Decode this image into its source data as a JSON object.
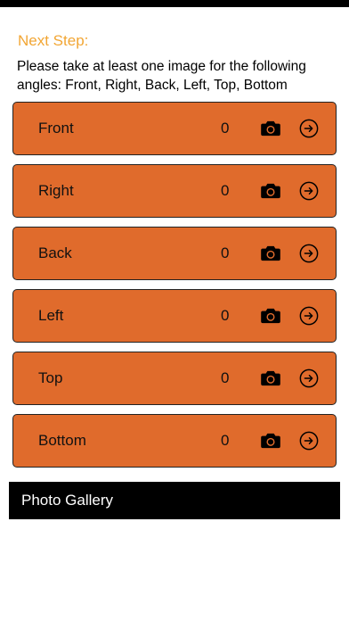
{
  "header": {
    "title": "Next Step:",
    "instructions": "Please take at least one image for the following angles: Front, Right, Back, Left, Top, Bottom"
  },
  "angles": [
    {
      "label": "Front",
      "count": "0",
      "camera_icon": "camera-icon",
      "action_icon": "arrow-right-circle-icon"
    },
    {
      "label": "Right",
      "count": "0",
      "camera_icon": "camera-icon",
      "action_icon": "arrow-right-circle-icon"
    },
    {
      "label": "Back",
      "count": "0",
      "camera_icon": "camera-icon",
      "action_icon": "arrow-right-circle-icon"
    },
    {
      "label": "Left",
      "count": "0",
      "camera_icon": "camera-icon",
      "action_icon": "arrow-right-circle-icon"
    },
    {
      "label": "Top",
      "count": "0",
      "camera_icon": "camera-icon",
      "action_icon": "arrow-right-circle-icon"
    },
    {
      "label": "Bottom",
      "count": "0",
      "camera_icon": "camera-icon",
      "action_icon": "arrow-right-circle-icon"
    }
  ],
  "gallery": {
    "label": "Photo Gallery"
  },
  "colors": {
    "accent": "#f2a634",
    "row_background": "#e06b2c",
    "gallery_background": "#000000"
  }
}
